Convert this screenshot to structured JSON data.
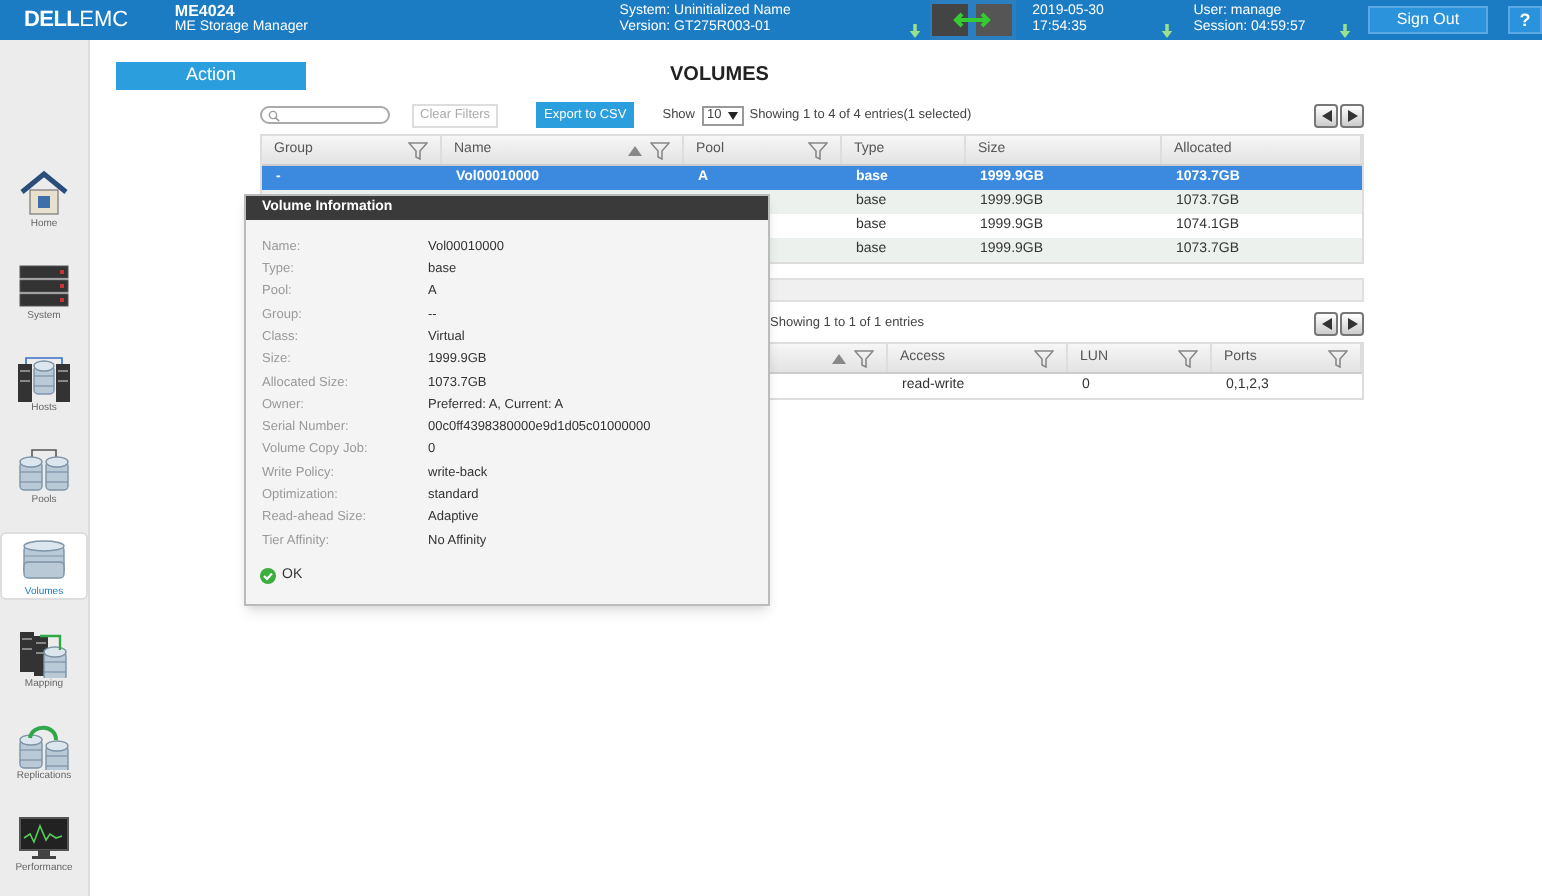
{
  "header": {
    "logo": {
      "brand": "DELL",
      "suffix": "EMC"
    },
    "product": "ME4024",
    "subtitle": "ME Storage Manager",
    "system": "System: Uninitialized Name",
    "version": "Version: GT275R003-01",
    "date": "2019-05-30",
    "time": "17:54:35",
    "user": "User: manage",
    "session": "Session: 04:59:57",
    "sign_out": "Sign Out",
    "help": "?"
  },
  "sidebar": {
    "items": [
      {
        "label": "Home",
        "kind": "home",
        "selected": false
      },
      {
        "label": "System",
        "kind": "system",
        "selected": false
      },
      {
        "label": "Hosts",
        "kind": "hosts",
        "selected": false
      },
      {
        "label": "Pools",
        "kind": "pools",
        "selected": false
      },
      {
        "label": "Volumes",
        "kind": "volumes",
        "selected": true
      },
      {
        "label": "Mapping",
        "kind": "mapping",
        "selected": false
      },
      {
        "label": "Replications",
        "kind": "replications",
        "selected": false
      },
      {
        "label": "Performance",
        "kind": "performance",
        "selected": false
      }
    ]
  },
  "action_button": "Action",
  "title": "VOLUMES",
  "volumes_table": {
    "clear_filters": "Clear Filters",
    "export": "Export to CSV",
    "show_label": "Show",
    "page_size": "10",
    "summary": "Showing 1 to 4 of 4 entries(1 selected)",
    "columns": [
      {
        "label": "Group",
        "filter": true,
        "sorted": false
      },
      {
        "label": "Name",
        "filter": true,
        "sorted": true
      },
      {
        "label": "Pool",
        "filter": true,
        "sorted": false
      },
      {
        "label": "Type",
        "filter": false,
        "sorted": false
      },
      {
        "label": "Size",
        "filter": false,
        "sorted": false
      },
      {
        "label": "Allocated",
        "filter": false,
        "sorted": false
      }
    ],
    "rows": [
      {
        "selected": true,
        "cells": [
          "-",
          "Vol00010000",
          "A",
          "base",
          "1999.9GB",
          "1073.7GB"
        ]
      },
      {
        "selected": false,
        "cells": [
          null,
          null,
          null,
          "base",
          "1999.9GB",
          "1073.7GB"
        ]
      },
      {
        "selected": false,
        "cells": [
          null,
          null,
          null,
          "base",
          "1999.9GB",
          "1074.1GB"
        ]
      },
      {
        "selected": false,
        "cells": [
          null,
          null,
          null,
          "base",
          "1999.9GB",
          "1073.7GB"
        ]
      }
    ]
  },
  "mapping_table": {
    "summary": "Showing 1 to 1 of 1 entries",
    "columns": [
      {
        "filter": true,
        "sorted": true
      },
      {
        "label": "Access",
        "filter": true,
        "sorted": false
      },
      {
        "label": "LUN",
        "filter": true,
        "sorted": false
      },
      {
        "label": "Ports",
        "filter": true,
        "sorted": false
      }
    ],
    "rows": [
      {
        "selected": false,
        "cells": [
          null,
          "read-write",
          "0",
          "0,1,2,3"
        ]
      }
    ]
  },
  "dialog": {
    "title": "Volume Information",
    "fields": [
      {
        "label": "Name:",
        "value": "Vol00010000"
      },
      {
        "label": "Type:",
        "value": "base"
      },
      {
        "label": "Pool:",
        "value": "A"
      },
      {
        "label": "Group:",
        "value": "--"
      },
      {
        "label": "Class:",
        "value": "Virtual"
      },
      {
        "label": "Size:",
        "value": "1999.9GB"
      },
      {
        "label": "Allocated Size:",
        "value": "1073.7GB"
      },
      {
        "label": "Owner:",
        "value": "Preferred: A, Current: A"
      },
      {
        "label": "Serial Number:",
        "value": "00c0ff4398380000e9d1d05c01000000"
      },
      {
        "label": "Volume Copy Job:",
        "value": "0"
      },
      {
        "label": "Write Policy:",
        "value": "write-back"
      },
      {
        "label": "Optimization:",
        "value": "standard"
      },
      {
        "label": "Read-ahead Size:",
        "value": "Adaptive"
      },
      {
        "label": "Tier Affinity:",
        "value": "No Affinity"
      }
    ],
    "ok": "OK"
  }
}
